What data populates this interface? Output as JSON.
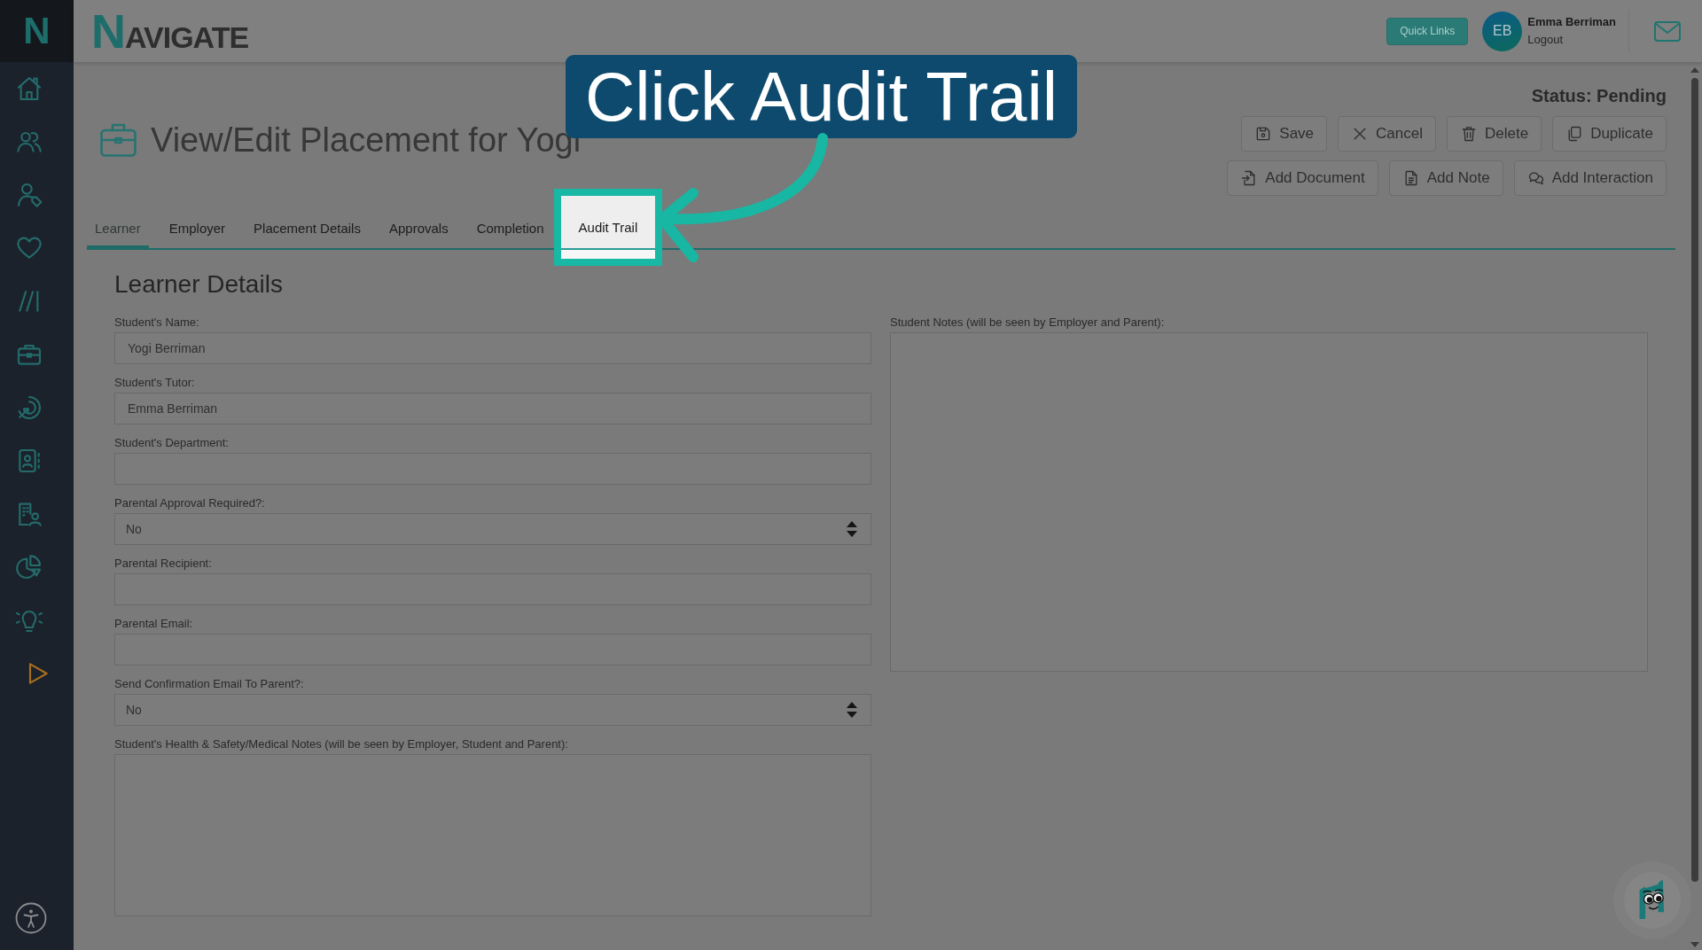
{
  "sidebar": {
    "logo": "N"
  },
  "header": {
    "logo": "NAVIGATE",
    "quick_links": "Quick Links",
    "user": {
      "initials": "EB",
      "name": "Emma Berriman",
      "logout": "Logout"
    }
  },
  "page": {
    "title": "View/Edit Placement for Yogi",
    "status": "Status: Pending",
    "action_rows": [
      [
        "Save",
        "Cancel",
        "Delete",
        "Duplicate"
      ],
      [
        "Add Document",
        "Add Note",
        "Add Interaction"
      ]
    ]
  },
  "tabs": [
    {
      "label": "Learner",
      "selected": true,
      "highlighted": false
    },
    {
      "label": "Employer",
      "selected": false,
      "highlighted": false
    },
    {
      "label": "Placement Details",
      "selected": false,
      "highlighted": false
    },
    {
      "label": "Approvals",
      "selected": false,
      "highlighted": false
    },
    {
      "label": "Completion",
      "selected": false,
      "highlighted": false
    },
    {
      "label": "Audit Trail",
      "selected": false,
      "highlighted": true
    }
  ],
  "callout": {
    "text": "Click Audit Trail"
  },
  "section": {
    "title": "Learner Details",
    "left_fields": [
      {
        "label": "Student's Name:",
        "kind": "input",
        "value": "Yogi Berriman"
      },
      {
        "label": "Student's Tutor:",
        "kind": "input",
        "value": "Emma Berriman"
      },
      {
        "label": "Student's Department:",
        "kind": "input"
      },
      {
        "label": "Parental Approval Required?:",
        "kind": "select",
        "value": "No"
      },
      {
        "label": "Parental Recipient:",
        "kind": "input"
      },
      {
        "label": "Parental Email:",
        "kind": "input"
      },
      {
        "label": "Send Confirmation Email To Parent?:",
        "kind": "select",
        "value": "No"
      },
      {
        "label": "Student's Health & Safety/Medical Notes (will be seen by Employer, Student and Parent):",
        "kind": "textarea"
      }
    ],
    "right_fields": [
      {
        "label": "Student Notes (will be seen by Employer and Parent):",
        "kind": "textarea"
      }
    ]
  }
}
